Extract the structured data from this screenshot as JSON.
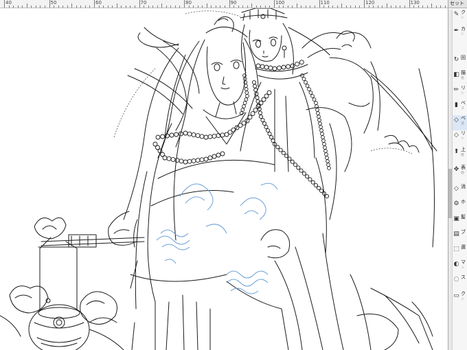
{
  "ruler": {
    "ticks": [
      "40",
      "50",
      "60",
      "70",
      "80",
      "90",
      "100",
      "110",
      "120",
      "130"
    ]
  },
  "panel": {
    "header": "セット",
    "tools": [
      {
        "label": "ク",
        "sub": "シ",
        "icon": "brush-icon"
      },
      {
        "label": "カ",
        "sub": "シ",
        "icon": "pen-nib-icon"
      },
      {
        "label": "回",
        "sub": "",
        "icon": "rotate-icon"
      },
      {
        "label": "描",
        "sub": "色",
        "icon": "fill-bucket-icon"
      },
      {
        "label": "リ",
        "sub": "シ",
        "icon": "pencil-icon"
      },
      {
        "label": "ベ",
        "sub": "ス",
        "icon": "marker-icon"
      },
      {
        "label": "ベ",
        "sub": "透",
        "icon": "eraser-icon"
      },
      {
        "label": "リ",
        "sub": "シ",
        "icon": "eraser-icon"
      },
      {
        "label": "上",
        "sub": "度",
        "icon": "move-icon"
      },
      {
        "label": "表",
        "sub": "題",
        "icon": "move-arrows-icon"
      },
      {
        "label": "消",
        "sub": "",
        "icon": "eraser-icon"
      },
      {
        "label": "ホ",
        "sub": "",
        "icon": "gear-icon"
      },
      {
        "label": "髪",
        "sub": "",
        "icon": "selection-icon"
      },
      {
        "label": "ブ",
        "sub": "",
        "icon": "layer-icon"
      },
      {
        "label": "選",
        "sub": "",
        "icon": "select-icon"
      },
      {
        "label": "マ",
        "sub": "ン",
        "icon": "mask-icon"
      },
      {
        "label": "ス",
        "sub": "",
        "icon": "lasso-icon"
      },
      {
        "label": "ク",
        "sub": "ン",
        "icon": "marquee-icon"
      }
    ]
  },
  "colors": {
    "line_art": "#111111",
    "blue_layer": "#6b9fd6",
    "panel_bg": "#f6f6f6"
  }
}
